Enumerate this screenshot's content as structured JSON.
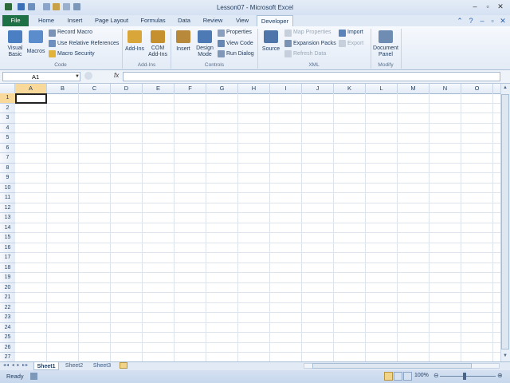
{
  "window": {
    "title": "Lesson07 - Microsoft Excel"
  },
  "tabs": [
    {
      "label": "File"
    },
    {
      "label": "Home"
    },
    {
      "label": "Insert"
    },
    {
      "label": "Page Layout"
    },
    {
      "label": "Formulas"
    },
    {
      "label": "Data"
    },
    {
      "label": "Review"
    },
    {
      "label": "View"
    },
    {
      "label": "Developer"
    }
  ],
  "ribbon": {
    "code": {
      "visual_basic": "Visual Basic",
      "macros": "Macros",
      "record_macro": "Record Macro",
      "use_relative_references": "Use Relative References",
      "macro_security": "Macro Security",
      "group": "Code"
    },
    "addins": {
      "addins": "Add-Ins",
      "com_addins": "COM Add-Ins",
      "group": "Add-Ins"
    },
    "controls": {
      "insert": "Insert",
      "design_mode": "Design Mode",
      "properties": "Properties",
      "view_code": "View Code",
      "run_dialog": "Run Dialog",
      "group": "Controls"
    },
    "xml": {
      "source": "Source",
      "map_properties": "Map Properties",
      "expansion_packs": "Expansion Packs",
      "refresh_data": "Refresh Data",
      "import": "Import",
      "export": "Export",
      "group": "XML"
    },
    "modify": {
      "document_panel": "Document Panel",
      "group": "Modify"
    }
  },
  "formula_bar": {
    "name_box": "A1",
    "fx": "fx",
    "value": ""
  },
  "columns": [
    "A",
    "B",
    "C",
    "D",
    "E",
    "F",
    "G",
    "H",
    "I",
    "J",
    "K",
    "L",
    "M",
    "N",
    "O"
  ],
  "rows": [
    "1",
    "2",
    "3",
    "4",
    "5",
    "6",
    "7",
    "8",
    "9",
    "10",
    "11",
    "12",
    "13",
    "14",
    "15",
    "16",
    "17",
    "18",
    "19",
    "20",
    "21",
    "22",
    "23",
    "24",
    "25",
    "26",
    "27"
  ],
  "sheets": [
    "Sheet1",
    "Sheet2",
    "Sheet3"
  ],
  "status": {
    "ready": "Ready",
    "zoom": "100%"
  },
  "colors": {
    "file_tab": "#1e7145",
    "ribbon_bg": "#e3ebf6",
    "selection": "#222222"
  }
}
